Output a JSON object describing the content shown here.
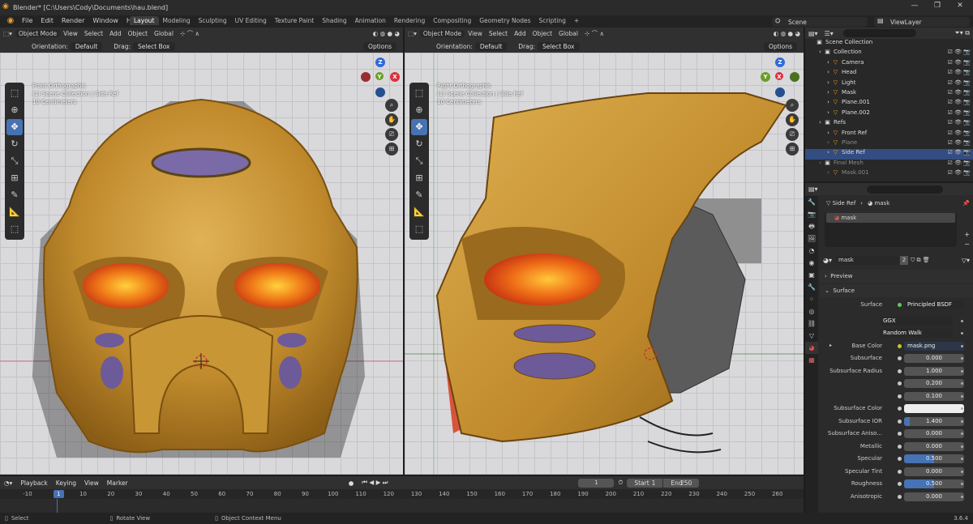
{
  "titlebar": {
    "title": "Blender* [C:\\Users\\Cody\\Documents\\hau.blend]"
  },
  "menu": [
    "File",
    "Edit",
    "Render",
    "Window",
    "Help"
  ],
  "workspaces": [
    "Layout",
    "Modeling",
    "Sculpting",
    "UV Editing",
    "Texture Paint",
    "Shading",
    "Animation",
    "Rendering",
    "Compositing",
    "Geometry Nodes",
    "Scripting",
    "+"
  ],
  "scene": "Scene",
  "view_layer": "ViewLayer",
  "viewport_header": {
    "mode": "Object Mode",
    "menus": [
      "View",
      "Select",
      "Add",
      "Object"
    ],
    "transform": "Global",
    "orientation_label": "Orientation:",
    "orientation_value": "Default",
    "drag_label": "Drag:",
    "drag_value": "Select Box",
    "options": "Options"
  },
  "viewport_left": {
    "view_name": "Front Orthographic",
    "collection": "(1) Scene Collection | Side Ref",
    "scale": "10 Centimeters"
  },
  "viewport_right": {
    "view_name": "Right Orthographic",
    "collection": "(1) Scene Collection | Side Ref",
    "scale": "10 Centimeters"
  },
  "axes": {
    "x": "X",
    "y": "Y",
    "z": "Z"
  },
  "outliner": {
    "rows": [
      {
        "label": "Scene Collection",
        "indent": 0,
        "icon": "▣"
      },
      {
        "label": "Collection",
        "indent": 1,
        "icon": "▣"
      },
      {
        "label": "Camera",
        "indent": 2,
        "icon": "▽"
      },
      {
        "label": "Head",
        "indent": 2,
        "icon": "▽"
      },
      {
        "label": "Light",
        "indent": 2,
        "icon": "▽"
      },
      {
        "label": "Mask",
        "indent": 2,
        "icon": "▽"
      },
      {
        "label": "Plane.001",
        "indent": 2,
        "icon": "▽"
      },
      {
        "label": "Plane.002",
        "indent": 2,
        "icon": "▽"
      },
      {
        "label": "Refs",
        "indent": 1,
        "icon": "▣"
      },
      {
        "label": "Front Ref",
        "indent": 2,
        "icon": "▽"
      },
      {
        "label": "Plane",
        "indent": 2,
        "icon": "▽",
        "dim": true
      },
      {
        "label": "Side Ref",
        "indent": 2,
        "icon": "▽",
        "selected": true
      },
      {
        "label": "Final Mesh",
        "indent": 1,
        "icon": "▣",
        "dim": true
      },
      {
        "label": "Mask.001",
        "indent": 2,
        "icon": "▽",
        "dim": true
      }
    ]
  },
  "properties": {
    "breadcrumb_object": "Side Ref",
    "breadcrumb_material": "mask",
    "material_slot": "mask",
    "material_name": "mask",
    "user_count": "2",
    "sections": {
      "preview": "Preview",
      "surface": "Surface"
    },
    "surface_label": "Surface",
    "surface_value": "Principled BSDF",
    "distribution": "GGX",
    "subsurface_method": "Random Walk",
    "rows": [
      {
        "label": "Base Color",
        "value": "mask.png",
        "dark": true
      },
      {
        "label": "Subsurface",
        "value": "0.000",
        "fill": 0
      },
      {
        "label": "Subsurface Radius",
        "value": "1.000",
        "fill": 0
      },
      {
        "label": "",
        "value": "0.200",
        "fill": 0
      },
      {
        "label": "",
        "value": "0.100",
        "fill": 0
      },
      {
        "label": "Subsurface Color",
        "value": "",
        "white": true
      },
      {
        "label": "Subsurface IOR",
        "value": "1.400",
        "fill": 0.1
      },
      {
        "label": "Subsurface Aniso...",
        "value": "0.000",
        "fill": 0
      },
      {
        "label": "Metallic",
        "value": "0.000",
        "fill": 0
      },
      {
        "label": "Specular",
        "value": "0.500",
        "fill": 0.5
      },
      {
        "label": "Specular Tint",
        "value": "0.000",
        "fill": 0
      },
      {
        "label": "Roughness",
        "value": "0.500",
        "fill": 0.5
      },
      {
        "label": "Anisotropic",
        "value": "0.000",
        "fill": 0
      }
    ]
  },
  "timeline": {
    "menus": [
      "Playback",
      "Keying",
      "View",
      "Marker"
    ],
    "current_frame": "1",
    "start_label": "Start",
    "start": "1",
    "end_label": "End",
    "end": "250",
    "ticks": [
      "-10",
      "1",
      "10",
      "20",
      "30",
      "40",
      "50",
      "60",
      "70",
      "80",
      "90",
      "100",
      "110",
      "120",
      "130",
      "140",
      "150",
      "160",
      "170",
      "180",
      "190",
      "200",
      "210",
      "220",
      "230",
      "240",
      "250",
      "260"
    ]
  },
  "statusbar": {
    "select": "Select",
    "rotate": "Rotate View",
    "context": "Object Context Menu",
    "version": "3.6.4"
  }
}
